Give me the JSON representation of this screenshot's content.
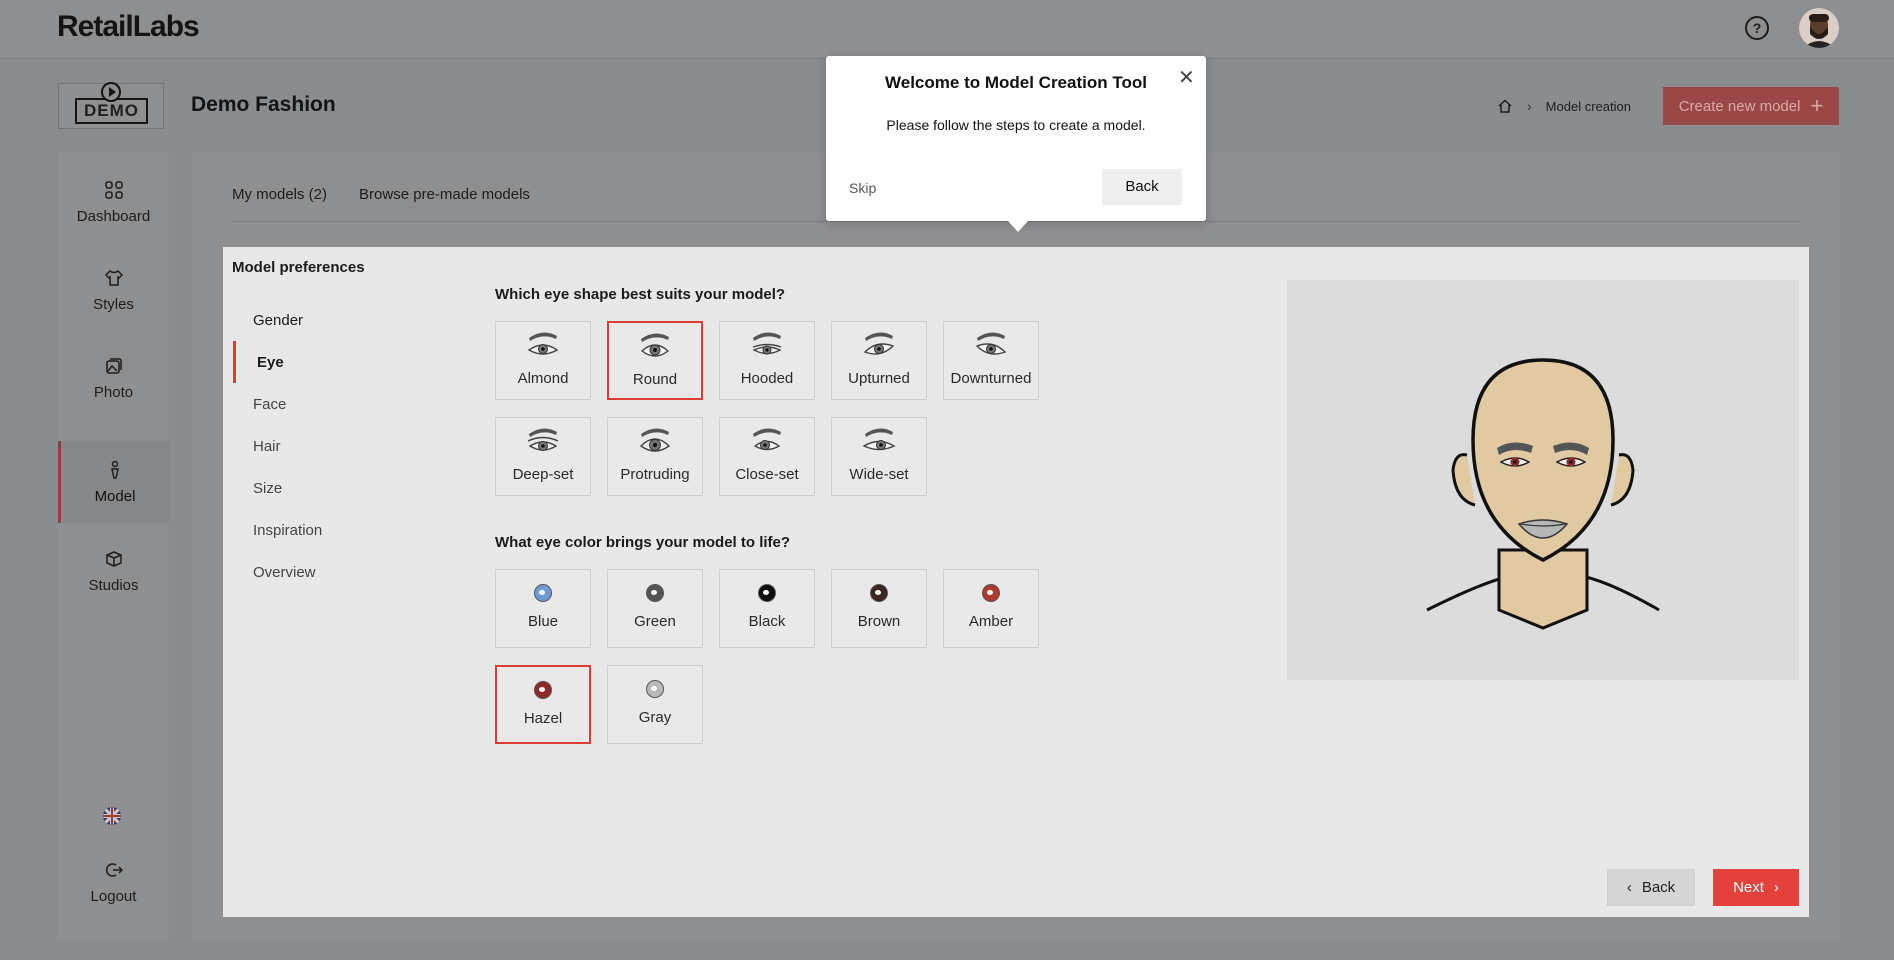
{
  "app": {
    "brand": "RetailLabs",
    "org_name": "Demo Fashion",
    "demo_logo": "DEMO"
  },
  "header": {
    "help_icon": "question-circle-icon",
    "avatar": "user-avatar"
  },
  "breadcrumb": {
    "current": "Model creation"
  },
  "actions": {
    "create_new_model": "Create new model"
  },
  "sidebar": {
    "items": [
      {
        "label": "Dashboard",
        "icon": "grid-icon"
      },
      {
        "label": "Styles",
        "icon": "shirt-icon"
      },
      {
        "label": "Photo",
        "icon": "photo-icon"
      },
      {
        "label": "Model",
        "icon": "person-icon",
        "active": true
      },
      {
        "label": "Studios",
        "icon": "box-icon"
      }
    ],
    "logout": "Logout"
  },
  "tabs": {
    "my_models": "My models (2)",
    "premade": "Browse pre-made models"
  },
  "card": {
    "title": "Model preferences",
    "steps": [
      "Gender",
      "Eye",
      "Face",
      "Hair",
      "Size",
      "Inspiration",
      "Overview"
    ],
    "active_step": "Eye"
  },
  "eye_shape": {
    "question": "Which eye shape best suits your model?",
    "options": [
      "Almond",
      "Round",
      "Hooded",
      "Upturned",
      "Downturned",
      "Deep-set",
      "Protruding",
      "Close-set",
      "Wide-set"
    ],
    "selected": "Round"
  },
  "eye_color": {
    "question": "What eye color brings your model to life?",
    "options": [
      {
        "label": "Blue",
        "color": "#6f9ad6"
      },
      {
        "label": "Green",
        "color": "#555555"
      },
      {
        "label": "Black",
        "color": "#0d0d0d"
      },
      {
        "label": "Brown",
        "color": "#3a2622"
      },
      {
        "label": "Amber",
        "color": "#b0392f"
      },
      {
        "label": "Hazel",
        "color": "#8e2b2a"
      },
      {
        "label": "Gray",
        "color": "#b9b9b9"
      }
    ],
    "selected": "Hazel"
  },
  "navigation": {
    "back": "Back",
    "next": "Next"
  },
  "popover": {
    "title": "Welcome to Model Creation Tool",
    "text": "Please follow the steps to create a model.",
    "skip": "Skip",
    "back": "Back"
  },
  "colors": {
    "accent": "#e2423b",
    "selected_border": "#dc3c35",
    "skin": "#e1c9a2"
  }
}
